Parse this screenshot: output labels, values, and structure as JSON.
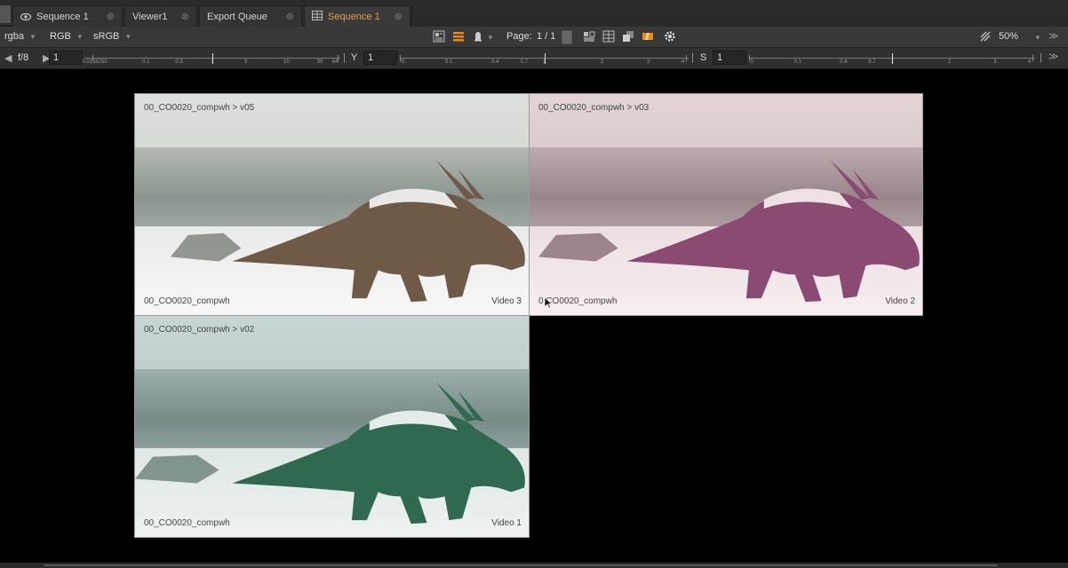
{
  "tabs": [
    {
      "label": "Sequence 1",
      "icon": "eye-icon",
      "active": false
    },
    {
      "label": "Viewer1",
      "icon": "",
      "active": false
    },
    {
      "label": "Export Queue",
      "icon": "",
      "active": false
    },
    {
      "label": "Sequence 1",
      "icon": "grid-icon",
      "active": true
    }
  ],
  "toolbar": {
    "channels": "rgba",
    "display_channel": "RGB",
    "colorspace": "sRGB",
    "page_label": "Page:",
    "page_value": "1 / 1",
    "zoom": "50%"
  },
  "sliders": {
    "fstop_label": "f/8",
    "fstop_value": "1",
    "gain_ticks": [
      "0.0156250",
      "0.1",
      "0.3",
      "1",
      "3",
      "10",
      "30",
      "64"
    ],
    "gamma_label": "Y",
    "gamma_value": "1",
    "gamma_ticks": [
      "0",
      "0.1",
      "0.4",
      "0.7",
      "1",
      "2",
      "3",
      "4"
    ],
    "sat_label": "S",
    "sat_value": "1",
    "sat_ticks": [
      "0",
      "0.1",
      "0.4",
      "0.7",
      "1",
      "2",
      "3",
      "4"
    ]
  },
  "panels": [
    {
      "top_label": "00_CO0020_compwh > v05",
      "bottom_label": "00_CO0020_compwh",
      "track_label": "Video 3",
      "tint": "brown"
    },
    {
      "top_label": "00_CO0020_compwh > v03",
      "bottom_label": "0  CO0020_compwh",
      "track_label": "Video 2",
      "tint": "magenta"
    },
    {
      "top_label": "00_CO0020_compwh > v02",
      "bottom_label": "00_CO0020_compwh",
      "track_label": "Video 1",
      "tint": "green"
    }
  ],
  "colors": {
    "active_tab": "#e8a04a",
    "accent_orange": "#e8891a"
  }
}
